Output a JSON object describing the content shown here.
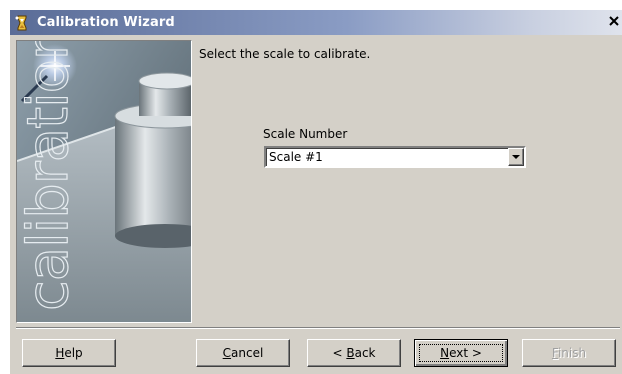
{
  "window": {
    "title": "Calibration Wizard",
    "close_glyph": "×"
  },
  "side_panel": {
    "image_name": "calibration-weight-image",
    "watermark": "calibration"
  },
  "page": {
    "instruction": "Select the scale to calibrate."
  },
  "scale_select": {
    "label": "Scale Number",
    "value": "Scale #1",
    "options": [
      "Scale #1"
    ]
  },
  "buttons": {
    "help": {
      "pre": "",
      "key": "H",
      "post": "elp",
      "enabled": true
    },
    "cancel": {
      "pre": "",
      "key": "C",
      "post": "ancel",
      "enabled": true
    },
    "back": {
      "pre": "< ",
      "key": "B",
      "post": "ack",
      "enabled": true
    },
    "next": {
      "pre": "",
      "key": "N",
      "post": "ext >",
      "enabled": true,
      "default": true
    },
    "finish": {
      "pre": "",
      "key": "F",
      "post": "inish",
      "enabled": false
    }
  },
  "colors": {
    "dialog_bg": "#d4d0c8",
    "titlebar_start": "#5a6c97",
    "titlebar_end": "#dfe3ec",
    "title_text": "#ffffff",
    "disabled_text": "#a0a0a0"
  },
  "icons": {
    "app": "wizard-icon",
    "close": "close-icon",
    "dropdown": "chevron-down-icon"
  }
}
